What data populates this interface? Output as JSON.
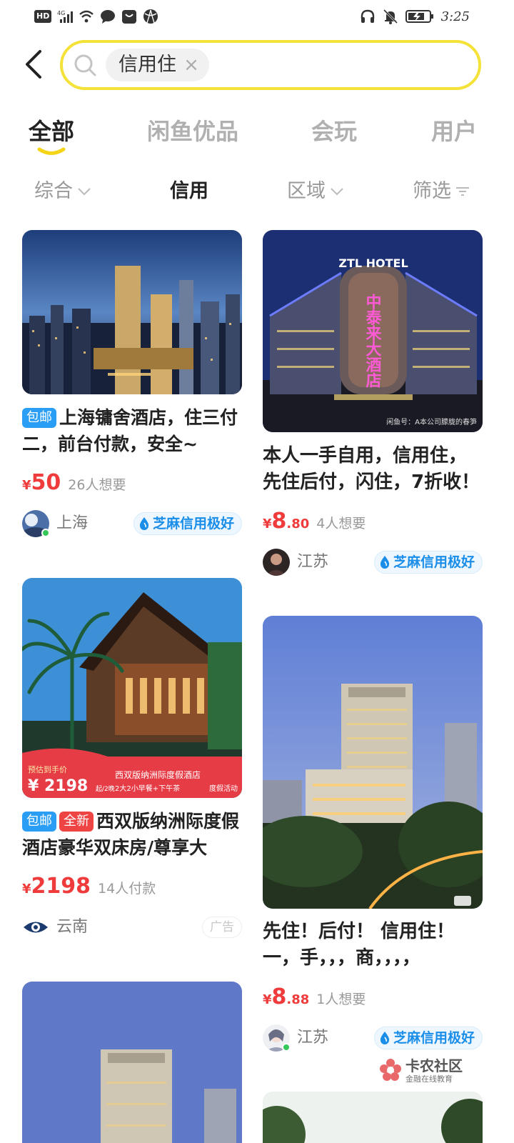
{
  "status_bar": {
    "hd": "HD",
    "network": "4G",
    "time": "3:25"
  },
  "search": {
    "query": "信用住"
  },
  "tabs": [
    {
      "label": "全部",
      "active": true
    },
    {
      "label": "闲鱼优品",
      "active": false
    },
    {
      "label": "会玩",
      "active": false
    },
    {
      "label": "用户",
      "active": false
    }
  ],
  "filters": [
    {
      "label": "综合"
    },
    {
      "label": "信用"
    },
    {
      "label": "区域"
    },
    {
      "label": "筛选"
    }
  ],
  "accent_color": "#f5e238",
  "price_color": "#ef3b3b",
  "listings": {
    "shanghai": {
      "tag": "包邮",
      "title": "上海镛舍酒店，住三付二，前台付款，安全~",
      "price_symbol": "¥",
      "price": "50",
      "wants": "26人想要",
      "region": "上海",
      "credit": "芝麻信用极好"
    },
    "ztl": {
      "image_text": "ZTL HOTEL",
      "image_sign": "中泰来大酒店",
      "image_caption": "闲鱼号：A本公司朦胧的春笋",
      "title": "本人一手自用，信用住，先住后付，闪住，7折收！",
      "price_symbol": "¥",
      "price_int": "8",
      "price_dec": ".80",
      "wants": "4人想要",
      "region": "江苏",
      "credit": "芝麻信用极好"
    },
    "xishuangbanna": {
      "tag1": "包邮",
      "tag2": "全新",
      "title": "西双版纳洲际度假酒店豪华双床房/尊享大",
      "banner_prefix": "预估到手价",
      "banner_price": "¥ 2198",
      "banner_unit": "起/2晚",
      "banner_name": "西双版纳洲际度假酒店",
      "banner_perks": "2大2小早餐+下午茶",
      "banner_event": "度假活动",
      "price_symbol": "¥",
      "price": "2198",
      "wants": "14人付款",
      "region": "云南",
      "ad": "广告"
    },
    "hilton": {
      "title": "先住！后付！ 信用住！一，手，，，商，，，，",
      "price_symbol": "¥",
      "price_int": "8",
      "price_dec": ".88",
      "wants": "1人想要",
      "region": "江苏",
      "credit": "芝麻信用极好"
    }
  },
  "watermark": {
    "name": "卡农社区",
    "sub": "金融在线教育"
  }
}
